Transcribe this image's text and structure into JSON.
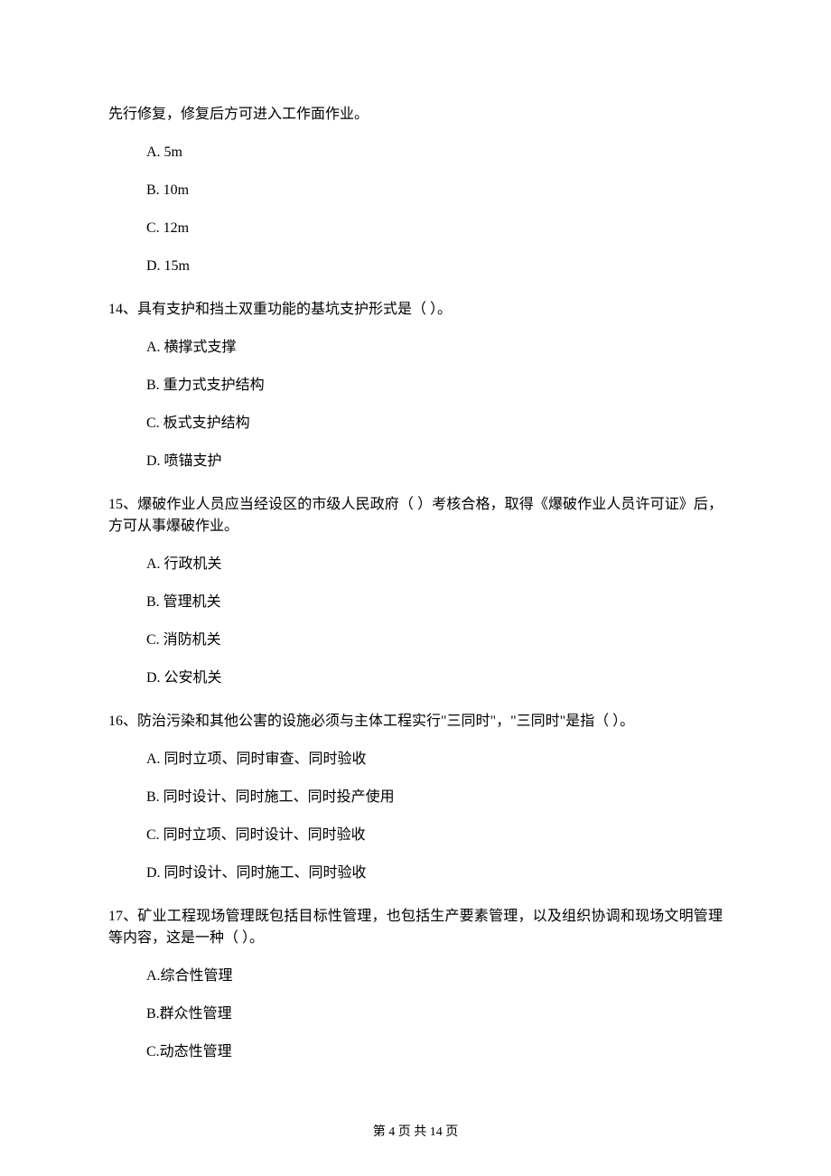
{
  "q13": {
    "continuation": "先行修复，修复后方可进入工作面作业。",
    "options": {
      "a": "A. 5m",
      "b": "B. 10m",
      "c": "C. 12m",
      "d": "D. 15m"
    }
  },
  "q14": {
    "stem": "14、具有支护和挡土双重功能的基坑支护形式是（   ）。",
    "options": {
      "a": "A. 横撑式支撑",
      "b": "B. 重力式支护结构",
      "c": "C. 板式支护结构",
      "d": "D. 喷锚支护"
    }
  },
  "q15": {
    "stem": "15、爆破作业人员应当经设区的市级人民政府（   ）考核合格，取得《爆破作业人员许可证》后，方可从事爆破作业。",
    "options": {
      "a": "A. 行政机关",
      "b": "B. 管理机关",
      "c": "C. 消防机关",
      "d": "D. 公安机关"
    }
  },
  "q16": {
    "stem": "16、防治污染和其他公害的设施必须与主体工程实行\"三同时\"，\"三同时\"是指（   ）。",
    "options": {
      "a": "A. 同时立项、同时审查、同时验收",
      "b": "B. 同时设计、同时施工、同时投产使用",
      "c": "C. 同时立项、同时设计、同时验收",
      "d": "D. 同时设计、同时施工、同时验收"
    }
  },
  "q17": {
    "stem": "17、矿业工程现场管理既包括目标性管理，也包括生产要素管理，以及组织协调和现场文明管理等内容，这是一种（   ）。",
    "options": {
      "a": "A.综合性管理",
      "b": "B.群众性管理",
      "c": "C.动态性管理"
    }
  },
  "footer": "第 4 页 共 14 页"
}
